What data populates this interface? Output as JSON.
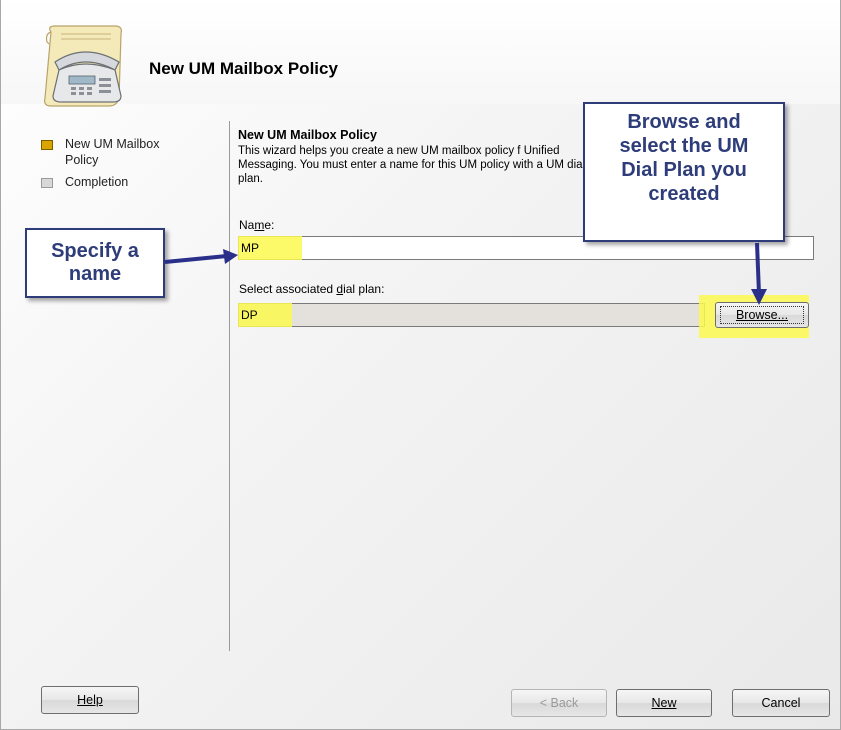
{
  "wizard": {
    "title": "New UM Mailbox Policy"
  },
  "steps": [
    {
      "label": "New UM Mailbox Policy",
      "state": "active"
    },
    {
      "label": "Completion",
      "state": "inactive"
    }
  ],
  "content": {
    "title": "New UM Mailbox Policy",
    "description": "This wizard helps you create a new UM mailbox policy f Unified Messaging. You must enter a name for this UM policy with a UM dial plan."
  },
  "form": {
    "name_label_pre": "Na",
    "name_label_key": "m",
    "name_label_post": "e:",
    "name_value": "MP",
    "plan_label_pre": "Select associated ",
    "plan_label_key": "d",
    "plan_label_post": "ial plan:",
    "plan_value": "DP",
    "browse_label": "Browse..."
  },
  "callouts": {
    "name_lines": [
      "Specify a",
      "name"
    ],
    "browse_lines": [
      "Browse and",
      "select the UM",
      "Dial Plan you",
      "created"
    ]
  },
  "buttons": {
    "help": "Help",
    "back": "< Back",
    "new": "New",
    "cancel": "Cancel"
  },
  "colors": {
    "callout_border": "#2e3d7a",
    "highlight": "#fcf94e",
    "active_step": "#d9a500"
  }
}
